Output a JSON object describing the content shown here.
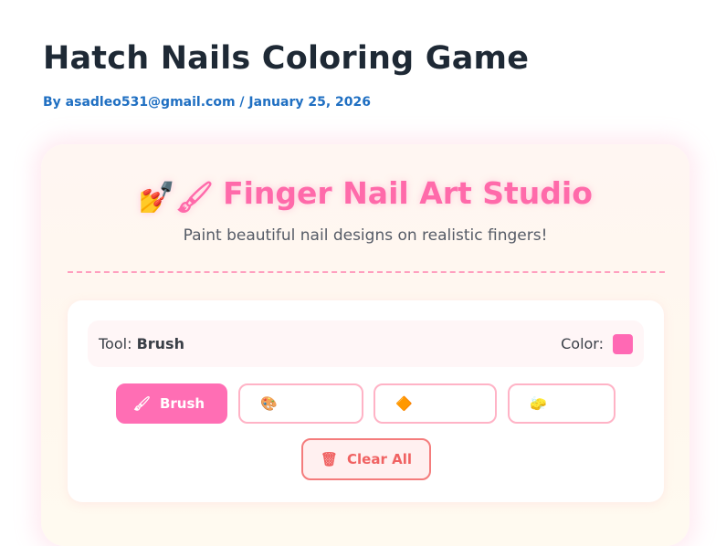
{
  "post": {
    "title": "Hatch Nails Coloring Game",
    "by_label": "By",
    "author": "asadleo531@gmail.com",
    "separator": "/",
    "date": "January 25, 2026"
  },
  "studio": {
    "title_emoji": "💅",
    "title_emoji_2": "🖌",
    "title": "Finger Nail Art Studio",
    "subtitle": "Paint beautiful nail designs on realistic fingers!"
  },
  "toolbar": {
    "tool_label": "Tool:",
    "tool_value": "Brush",
    "color_label": "Color:",
    "color_value": "#ff69b4"
  },
  "tools": [
    {
      "icon": "🖌",
      "icon_name": "brush-icon",
      "label": "Brush",
      "active": true
    },
    {
      "icon": "🎨",
      "icon_name": "palette-icon",
      "label": "",
      "active": false
    },
    {
      "icon": "🔶",
      "icon_name": "diamond-icon",
      "label": "",
      "active": false
    },
    {
      "icon": "🧽",
      "icon_name": "sponge-icon",
      "label": "",
      "active": false
    }
  ],
  "clear_button": {
    "icon": "🗑",
    "icon_name": "trash-icon",
    "label": "Clear All"
  },
  "colors": {
    "accent": "#ff6eb4",
    "title": "#1e2935",
    "link": "#1f6fc2",
    "danger": "#f06262"
  }
}
